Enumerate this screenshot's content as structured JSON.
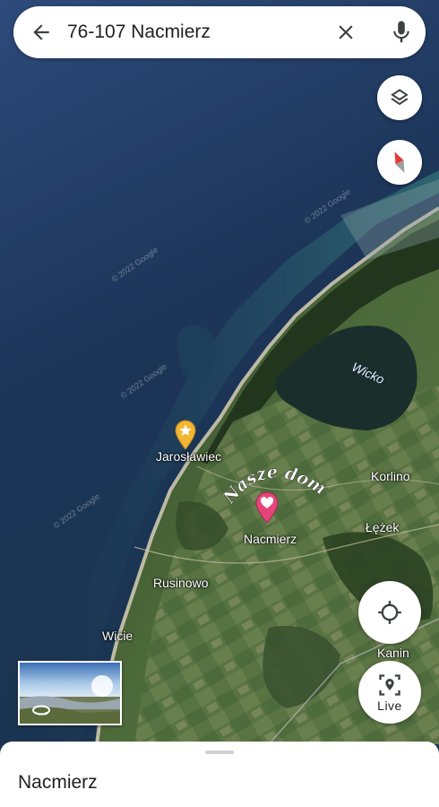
{
  "search": {
    "query": "76-107 Nacmierz"
  },
  "map": {
    "places": [
      {
        "id": "jaroslawiec",
        "label": "Jarosławiec"
      },
      {
        "id": "nacmierz",
        "label": "Nacmierz"
      },
      {
        "id": "korlino",
        "label": "Korlino"
      },
      {
        "id": "lezek",
        "label": "Łężek"
      },
      {
        "id": "rusinowo",
        "label": "Rusinowo"
      },
      {
        "id": "wicie",
        "label": "Wicie"
      },
      {
        "id": "kanin",
        "label": "Kanin"
      }
    ],
    "lake_label": "Wicko",
    "custom_label": "Nasze domki",
    "watermark": "© 2022 Google"
  },
  "controls": {
    "live_label": "Live"
  },
  "bottom_sheet": {
    "title": "Nacmierz"
  },
  "colors": {
    "sea_deep": "#1b3558",
    "land": "#3f5a2e",
    "pin_pink": "#e5457a",
    "pin_yellow": "#f2b632"
  }
}
